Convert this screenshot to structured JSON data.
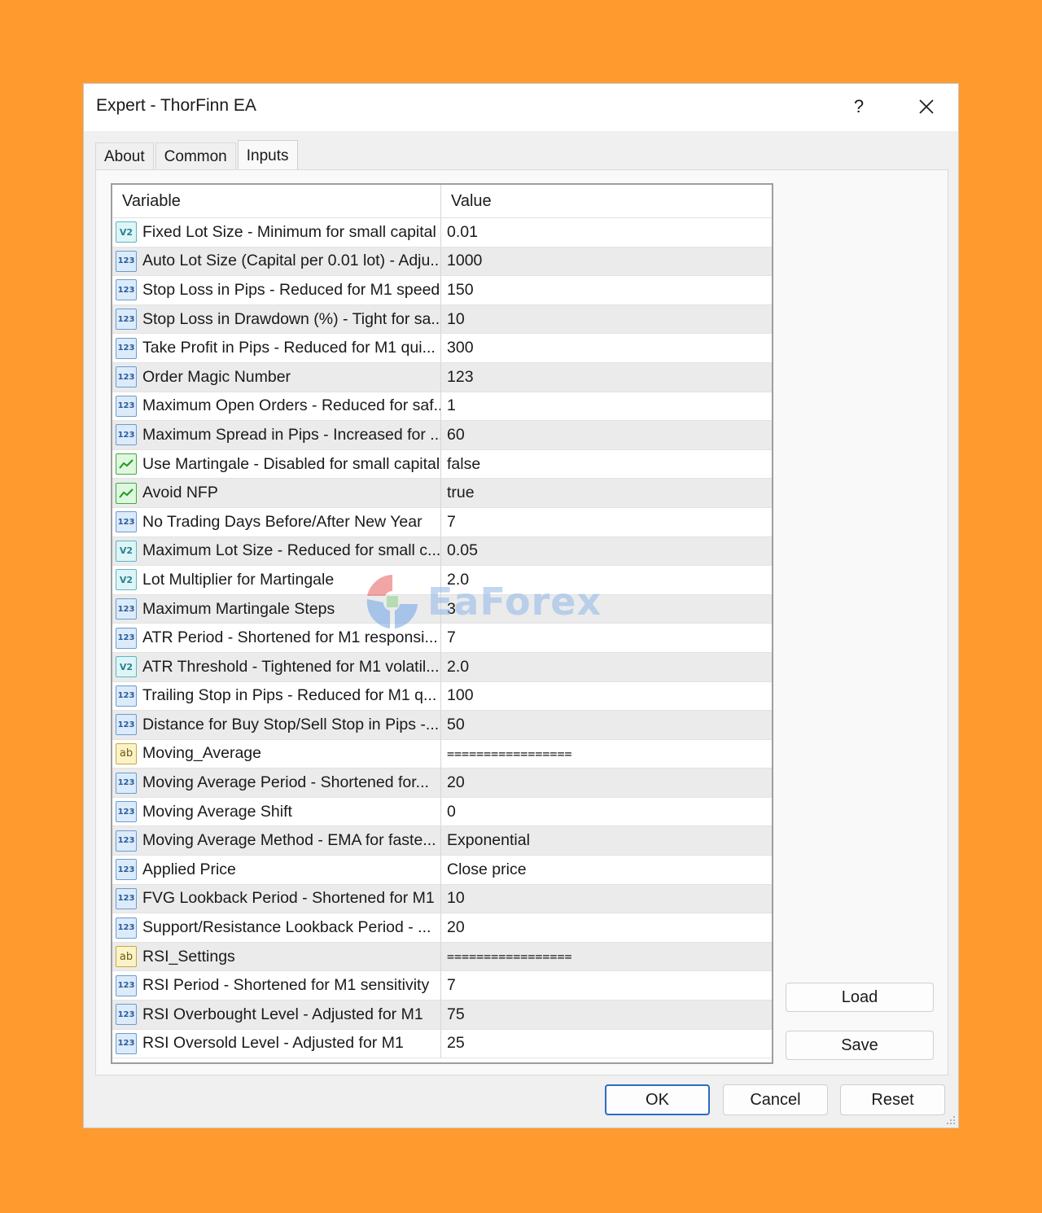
{
  "window": {
    "title": "Expert - ThorFinn EA",
    "help_label": "?"
  },
  "tabs": [
    {
      "label": "About"
    },
    {
      "label": "Common"
    },
    {
      "label": "Inputs",
      "active": true
    }
  ],
  "grid": {
    "columns": {
      "variable": "Variable",
      "value": "Value"
    },
    "icon_labels": {
      "int": "123",
      "double": "V2",
      "string": "ab"
    },
    "rows": [
      {
        "type": "double",
        "variable": "Fixed Lot Size - Minimum for small capital",
        "value": "0.01"
      },
      {
        "type": "int",
        "variable": "Auto Lot Size (Capital per 0.01 lot) - Adju...",
        "value": "1000"
      },
      {
        "type": "int",
        "variable": "Stop Loss in Pips - Reduced for M1 speed",
        "value": "150"
      },
      {
        "type": "int",
        "variable": "Stop Loss in Drawdown (%) - Tight for sa...",
        "value": "10"
      },
      {
        "type": "int",
        "variable": "Take Profit in Pips - Reduced for M1 qui...",
        "value": "300"
      },
      {
        "type": "int",
        "variable": "Order Magic Number",
        "value": "123"
      },
      {
        "type": "int",
        "variable": "Maximum Open Orders - Reduced for saf...",
        "value": "1"
      },
      {
        "type": "int",
        "variable": "Maximum Spread in Pips - Increased for ...",
        "value": "60"
      },
      {
        "type": "bool",
        "variable": "Use Martingale - Disabled for small capital",
        "value": "false"
      },
      {
        "type": "bool",
        "variable": "Avoid NFP",
        "value": "true"
      },
      {
        "type": "int",
        "variable": "No Trading Days Before/After New Year",
        "value": "7"
      },
      {
        "type": "double",
        "variable": "Maximum Lot Size - Reduced for small c...",
        "value": "0.05"
      },
      {
        "type": "double",
        "variable": "Lot Multiplier for Martingale",
        "value": "2.0"
      },
      {
        "type": "int",
        "variable": "Maximum Martingale Steps",
        "value": "3"
      },
      {
        "type": "int",
        "variable": "ATR Period - Shortened for M1 responsi...",
        "value": "7"
      },
      {
        "type": "double",
        "variable": "ATR Threshold - Tightened for M1 volatil...",
        "value": "2.0"
      },
      {
        "type": "int",
        "variable": "Trailing Stop in Pips - Reduced for M1 q...",
        "value": "100"
      },
      {
        "type": "int",
        "variable": "Distance for Buy Stop/Sell Stop in Pips -...",
        "value": "50"
      },
      {
        "type": "string",
        "variable": "Moving_Average",
        "value": "================="
      },
      {
        "type": "int",
        "variable": "Moving Average Period - Shortened for...",
        "value": "20"
      },
      {
        "type": "int",
        "variable": "Moving Average Shift",
        "value": "0"
      },
      {
        "type": "int",
        "variable": "Moving Average Method - EMA for faste...",
        "value": "Exponential"
      },
      {
        "type": "int",
        "variable": "Applied Price",
        "value": "Close price"
      },
      {
        "type": "int",
        "variable": "FVG Lookback Period - Shortened for M1",
        "value": "10"
      },
      {
        "type": "int",
        "variable": "Support/Resistance Lookback Period - ...",
        "value": "20"
      },
      {
        "type": "string",
        "variable": "RSI_Settings",
        "value": "================="
      },
      {
        "type": "int",
        "variable": "RSI Period - Shortened for M1 sensitivity",
        "value": "7"
      },
      {
        "type": "int",
        "variable": "RSI Overbought Level - Adjusted for M1",
        "value": "75"
      },
      {
        "type": "int",
        "variable": "RSI Oversold Level - Adjusted for M1",
        "value": "25"
      }
    ]
  },
  "side_buttons": {
    "load": "Load",
    "save": "Save"
  },
  "footer": {
    "ok": "OK",
    "cancel": "Cancel",
    "reset": "Reset"
  },
  "watermark": {
    "text": "EaForex"
  },
  "colors": {
    "background": "#FF9A2E",
    "dialog": "#F0F0F0",
    "primary_border": "#2B6CC4"
  }
}
